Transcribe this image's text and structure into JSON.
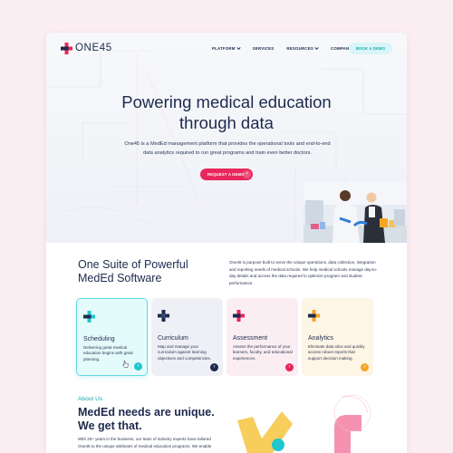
{
  "header": {
    "brand": "ONE45",
    "nav": [
      {
        "label": "PLATFORM",
        "dropdown": true
      },
      {
        "label": "SERVICES",
        "dropdown": false
      },
      {
        "label": "RESOURCES",
        "dropdown": true
      },
      {
        "label": "COMPANY",
        "dropdown": true
      }
    ],
    "cta_label": "BOOK A DEMO"
  },
  "hero": {
    "title_line1": "Powering medical education",
    "title_line2": "through data",
    "subtitle_line1": "One45 is a MedEd management platform that provides the operational tools and end-to-end",
    "subtitle_line2": "data analytics required to run great programs and train even better doctors.",
    "cta_label": "REQUEST A DEMO",
    "cta_arrow": "›"
  },
  "suite": {
    "title_line1": "One Suite of Powerful",
    "title_line2": "MedEd Software",
    "description": "One45 is purpose built to serve the unique operations, data collection, integration and reporting needs of medical schools. We help medical schools manage day-to-day details and access the data required to optimize program and student performance.",
    "cards": [
      {
        "title": "Scheduling",
        "description": "Delivering great medical education begins with great planning.",
        "color": "#1fc6cf",
        "bg": "#e4fbfb",
        "active": true,
        "icon": "plus-icon",
        "arrow": "›"
      },
      {
        "title": "Curriculum",
        "description": "Map and manage your curriculum against learning objectives and competencies.",
        "color": "#1d2a4d",
        "bg": "#eef0f6",
        "active": false,
        "icon": "plus-icon",
        "arrow": "›"
      },
      {
        "title": "Assessment",
        "description": "Assess the performance of your learners, faculty, and educational experiences.",
        "color": "#e8285c",
        "bg": "#fbeef2",
        "active": false,
        "icon": "plus-icon",
        "arrow": "›"
      },
      {
        "title": "Analytics",
        "description": "Eliminate data silos and quickly access robust reports that support decision making.",
        "color": "#f5a524",
        "bg": "#fdf5e6",
        "active": false,
        "icon": "plus-icon",
        "arrow": "›"
      }
    ]
  },
  "about": {
    "label": "About Us",
    "title_line1": "MedEd needs are unique.",
    "title_line2": "We get that.",
    "description_line1": "With 20+ years in the business, our team of industry experts have tailored",
    "description_line2": "One45 to the unique attributes of medical education programs. We enable"
  },
  "colors": {
    "brand_navy": "#1d2a4d",
    "brand_pink": "#e8285c",
    "brand_teal": "#1fc6cf",
    "brand_yellow": "#f5a524",
    "page_bg": "#fbeef2"
  }
}
